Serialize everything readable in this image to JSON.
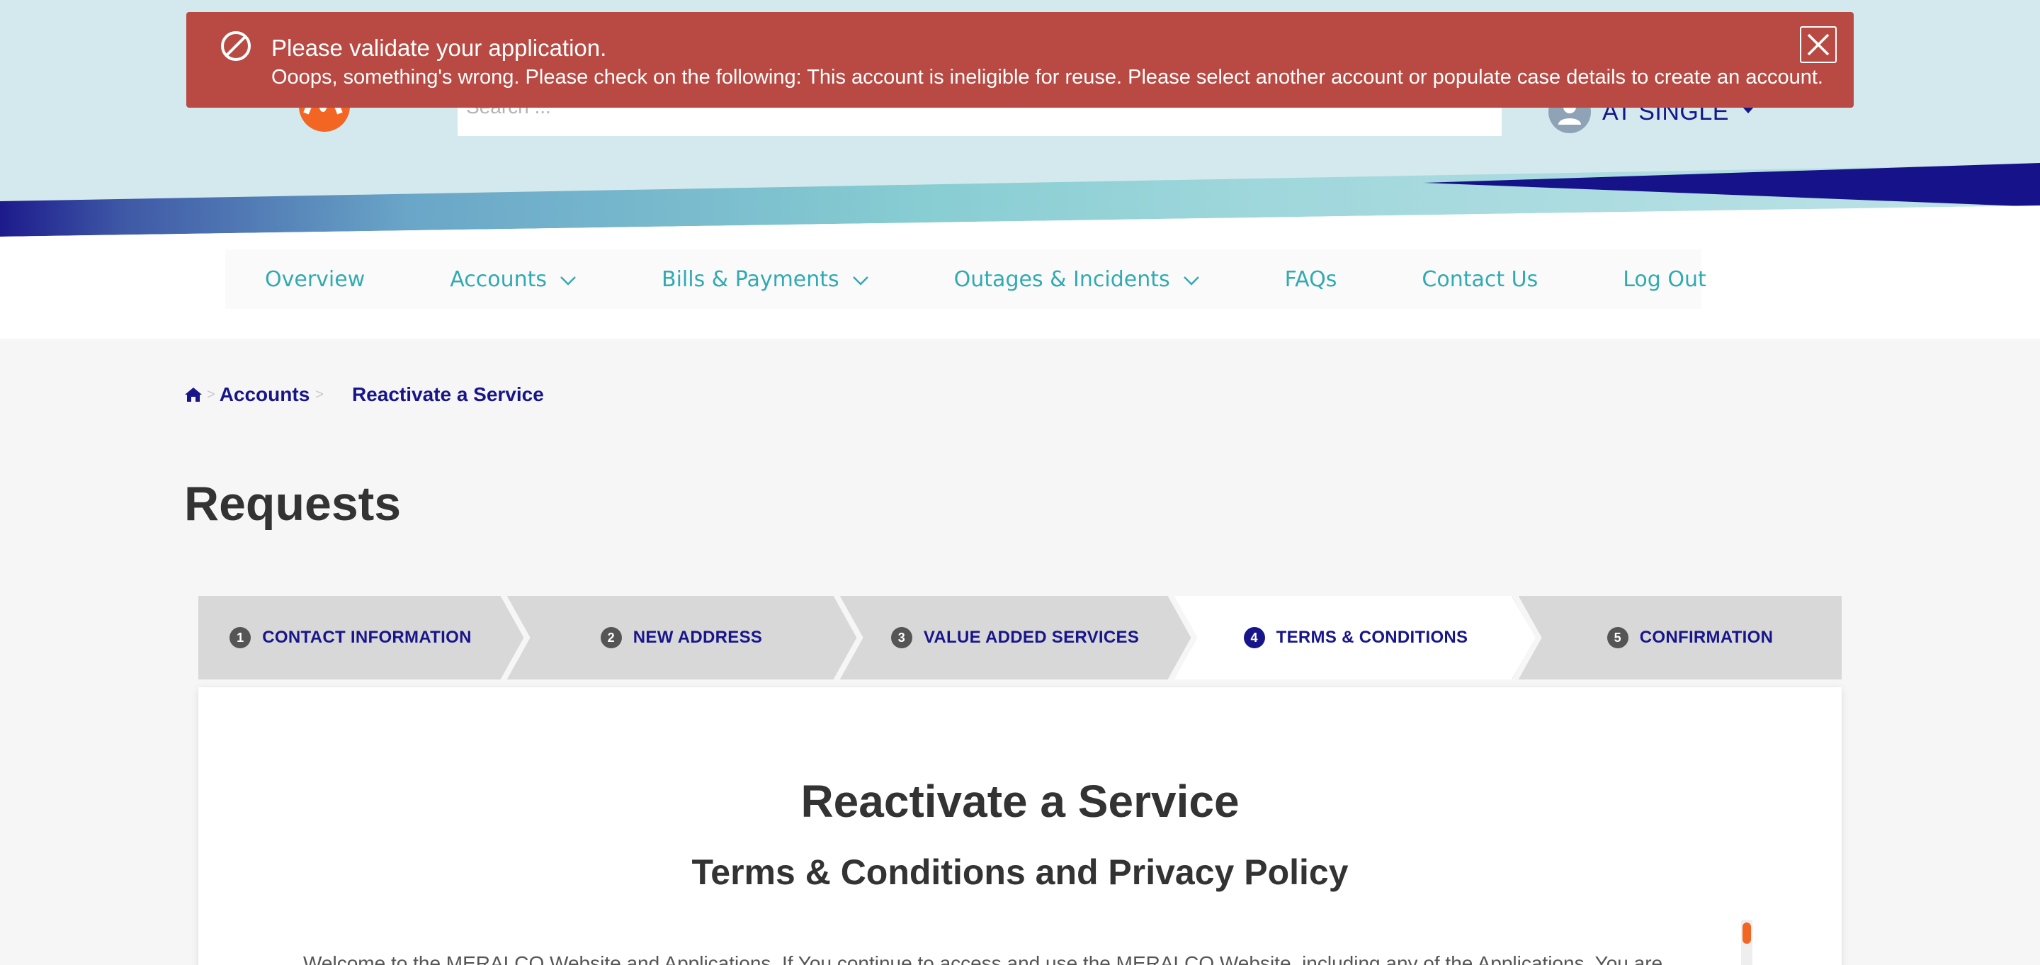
{
  "alert": {
    "title": "Please validate your application.",
    "message": "Ooops, something's wrong. Please check on the following: This account is ineligible for reuse. Please select another account or populate case details to create an account.",
    "color": "#b84a43"
  },
  "header": {
    "search_placeholder": "Search ...",
    "user_name": "AT SINGLE"
  },
  "nav": {
    "items": [
      {
        "label": "Overview"
      },
      {
        "label": "Accounts"
      },
      {
        "label": "Bills & Payments"
      },
      {
        "label": "Outages & Incidents"
      },
      {
        "label": "FAQs"
      },
      {
        "label": "Contact Us"
      },
      {
        "label": "Log Out"
      }
    ]
  },
  "breadcrumb": {
    "items": [
      "Accounts",
      "Reactivate a Service"
    ]
  },
  "page": {
    "title": "Requests"
  },
  "stepper": {
    "active_step": 4,
    "steps": [
      {
        "number": "1",
        "label": "CONTACT INFORMATION"
      },
      {
        "number": "2",
        "label": "NEW ADDRESS"
      },
      {
        "number": "3",
        "label": "VALUE ADDED SERVICES"
      },
      {
        "number": "4",
        "label": "TERMS & CONDITIONS"
      },
      {
        "number": "5",
        "label": "CONFIRMATION"
      }
    ]
  },
  "card": {
    "title": "Reactivate a Service",
    "subtitle": "Terms & Conditions and Privacy Policy",
    "body": "Welcome to the MERALCO Website and Applications. If You continue to access and use the MERALCO Website, including any of the Applications, You are"
  },
  "colors": {
    "brand_navy": "#17158a",
    "teal": "#32aab2",
    "accent_orange": "#f26522"
  }
}
